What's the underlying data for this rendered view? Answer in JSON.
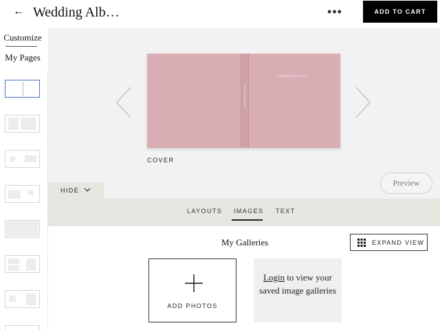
{
  "header": {
    "title": "Wedding Alb…",
    "back_icon": "←",
    "more_icon": "•••",
    "cart_label": "ADD TO CART"
  },
  "sidebar": {
    "tabs": [
      {
        "label": "Customize"
      },
      {
        "label": "My Pages"
      }
    ]
  },
  "editor": {
    "spine_text": "PERSONALIZE TEXT",
    "cover_text": "PERSONALIZE TEXT",
    "page_label": "COVER",
    "preview_label": "Preview",
    "hide_label": "HIDE",
    "book_color": "#d8adb4"
  },
  "tabs": {
    "items": [
      {
        "label": "LAYOUTS"
      },
      {
        "label": "IMAGES"
      },
      {
        "label": "TEXT"
      }
    ],
    "active": "IMAGES"
  },
  "galleries": {
    "title": "My Galleries",
    "expand_label": "EXPAND VIEW",
    "add_label": "ADD PHOTOS",
    "login_link": "Login",
    "login_rest": " to view your saved image galleries"
  }
}
